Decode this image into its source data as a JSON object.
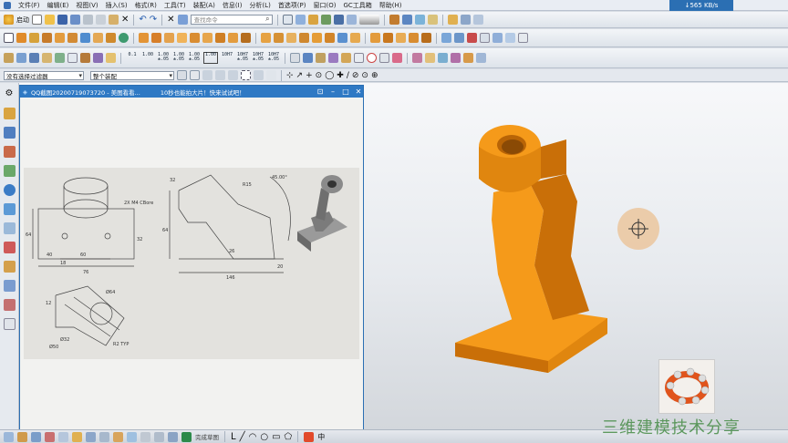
{
  "menu": {
    "items": [
      "文件(F)",
      "编辑(E)",
      "视图(V)",
      "插入(S)",
      "格式(R)",
      "工具(T)",
      "装配(A)",
      "信息(I)",
      "分析(L)",
      "首选项(P)",
      "窗口(O)",
      "GC工具箱",
      "帮助(H)"
    ],
    "net_speed": "565 KB/s"
  },
  "toolbar": {
    "start_label": "启动",
    "command_search_placeholder": "查找命令",
    "gdt_labels": [
      "0.1",
      "1.00",
      "1.00 ±.05",
      "1.00 ±.05",
      "1.00 ±.05",
      "1.00",
      "10H7",
      "10H7 ±.05",
      "10H7 ±.05",
      "10H7 ±.05"
    ]
  },
  "filterbar": {
    "filter_value": "没有选择过滤器",
    "scope_value": "整个装配"
  },
  "image_window": {
    "title": "QQ截图20200719073720 - 美图看看...",
    "promo": "10秒也能拍大片！快来试试吧！",
    "drawing_labels": {
      "cbore": "2X M4 CBore",
      "r15": "R15",
      "angle": "45.00°",
      "d32": "32",
      "d64a": "64",
      "d40": "40",
      "d60": "60",
      "d76": "76",
      "d18": "18",
      "d32b": "32",
      "d26": "26",
      "d20": "20",
      "d146": "146",
      "d64b": "64",
      "phi64": "Ø64",
      "phi32": "Ø32",
      "phi50": "Ø50",
      "d12": "12",
      "r2": "R2 TYP"
    }
  },
  "statusbar": {
    "sketch_label": "完成草图",
    "ime_label": "中"
  },
  "watermark": "三维建模技术分享",
  "colors": {
    "part": "#f59a1a",
    "part_shadow": "#c96f08",
    "part_light": "#ffb84d",
    "titlebar": "#2f79c4"
  }
}
